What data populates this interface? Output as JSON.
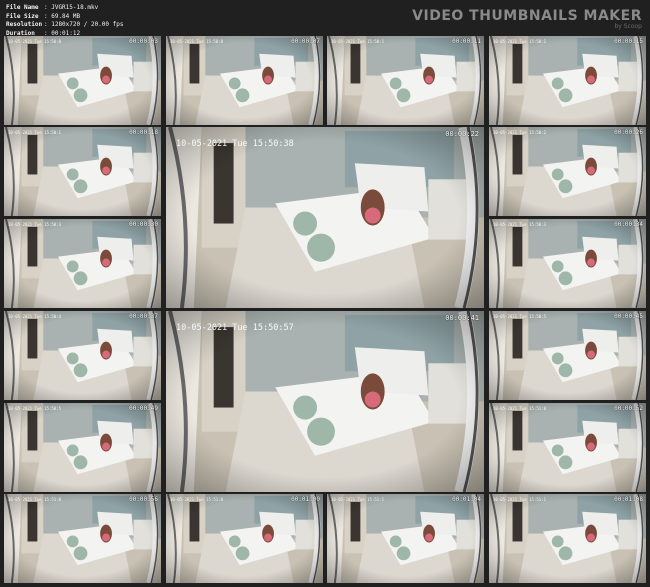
{
  "info": {
    "rows": [
      {
        "key": "File Name",
        "value": ":  JVGR15-18.mkv"
      },
      {
        "key": "File Size",
        "value": ":  69.84 MB"
      },
      {
        "key": "Resolution",
        "value": ":  1280x720 / 20.00 fps"
      },
      {
        "key": "Duration",
        "value": ":  00:01:12"
      }
    ]
  },
  "brand": {
    "title": "VIDEO THUMBNAILS MAKER",
    "subtitle": "by Scoop"
  },
  "thumbs": [
    {
      "time": "00:00:03",
      "date": "10-05-2021 Tue 15:50:0"
    },
    {
      "time": "00:00:07",
      "date": "10-05-2021 Tue 15:50:0"
    },
    {
      "time": "00:00:11",
      "date": "10-05-2021 Tue 15:50:1"
    },
    {
      "time": "00:00:15",
      "date": "10-05-2021 Tue 15:50:1"
    },
    {
      "time": "00:00:18",
      "date": "10-05-2021 Tue 15:50:1"
    },
    {
      "time": "00:00:22",
      "date": "10-05-2021 Tue 15:50:38"
    },
    {
      "time": "00:00:26",
      "date": "10-05-2021 Tue 15:50:2"
    },
    {
      "time": "00:00:30",
      "date": "10-05-2021 Tue 15:50:3"
    },
    {
      "time": "00:00:34",
      "date": "10-05-2021 Tue 15:50:3"
    },
    {
      "time": "00:00:37",
      "date": "10-05-2021 Tue 15:50:4"
    },
    {
      "time": "00:00:41",
      "date": "10-05-2021 Tue 15:50:57"
    },
    {
      "time": "00:00:45",
      "date": "10-05-2021 Tue 15:50:5"
    },
    {
      "time": "00:00:49",
      "date": "10-05-2021 Tue 15:50:5"
    },
    {
      "time": "00:00:52",
      "date": "10-05-2021 Tue 15:51:0"
    },
    {
      "time": "00:00:56",
      "date": "10-05-2021 Tue 15:51:0"
    },
    {
      "time": "00:01:00",
      "date": "10-05-2021 Tue 15:51:0"
    },
    {
      "time": "00:01:04",
      "date": "10-05-2021 Tue 15:51:1"
    },
    {
      "time": "00:01:08",
      "date": "10-05-2021 Tue 15:51:1"
    }
  ]
}
